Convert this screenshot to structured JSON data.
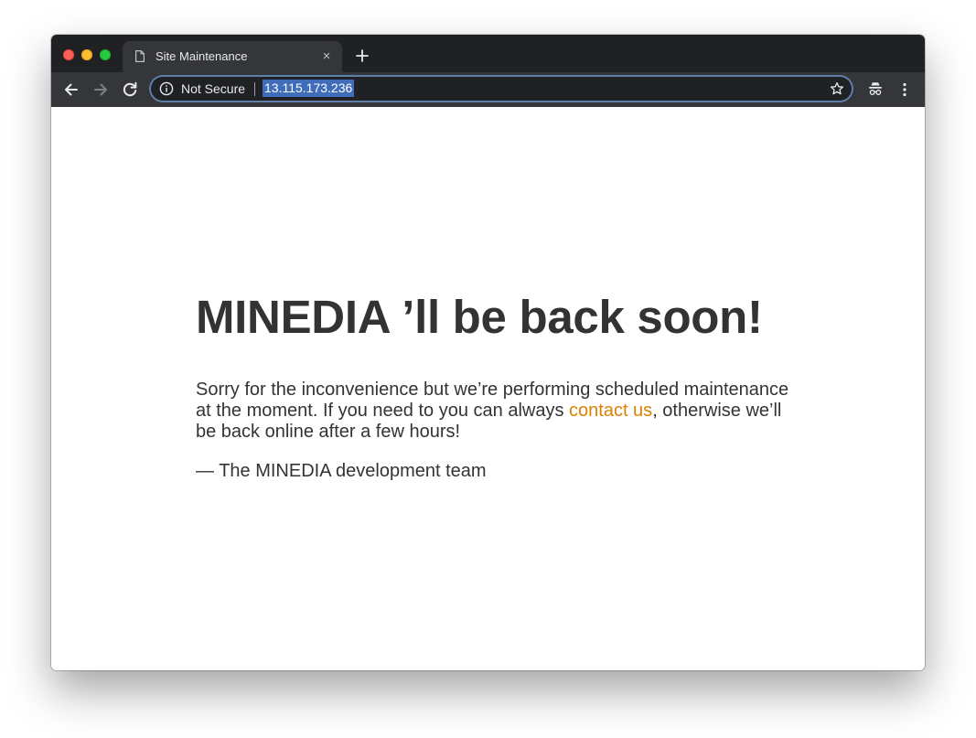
{
  "browser": {
    "tab": {
      "title": "Site Maintenance",
      "favicon": "document-icon",
      "close_glyph": "×"
    },
    "new_tab_icon": "plus-icon",
    "nav": {
      "back_icon": "arrow-left-icon",
      "forward_icon": "arrow-right-icon",
      "reload_icon": "reload-icon"
    },
    "omnibox": {
      "security_icon": "info-icon",
      "security_label": "Not Secure",
      "url": "13.115.173.236",
      "url_selected": true,
      "bookmark_icon": "star-icon"
    },
    "toolbar_icons": [
      "incognito-icon",
      "kebab-menu-icon"
    ],
    "colors": {
      "tabstrip": "#202124",
      "toolbar": "#35363a",
      "url_highlight": "#3f6dbb"
    }
  },
  "page": {
    "headline": "MINEDIA ’ll be back soon!",
    "message_part1": "Sorry for the inconvenience but we’re performing scheduled maintenance at the moment. If you need to you can always ",
    "link_text": "contact us",
    "message_part2": ", otherwise we’ll be back online after a few hours!",
    "signature": "— The MINEDIA development team",
    "colors": {
      "text": "#333333",
      "link": "#dc8100"
    }
  }
}
